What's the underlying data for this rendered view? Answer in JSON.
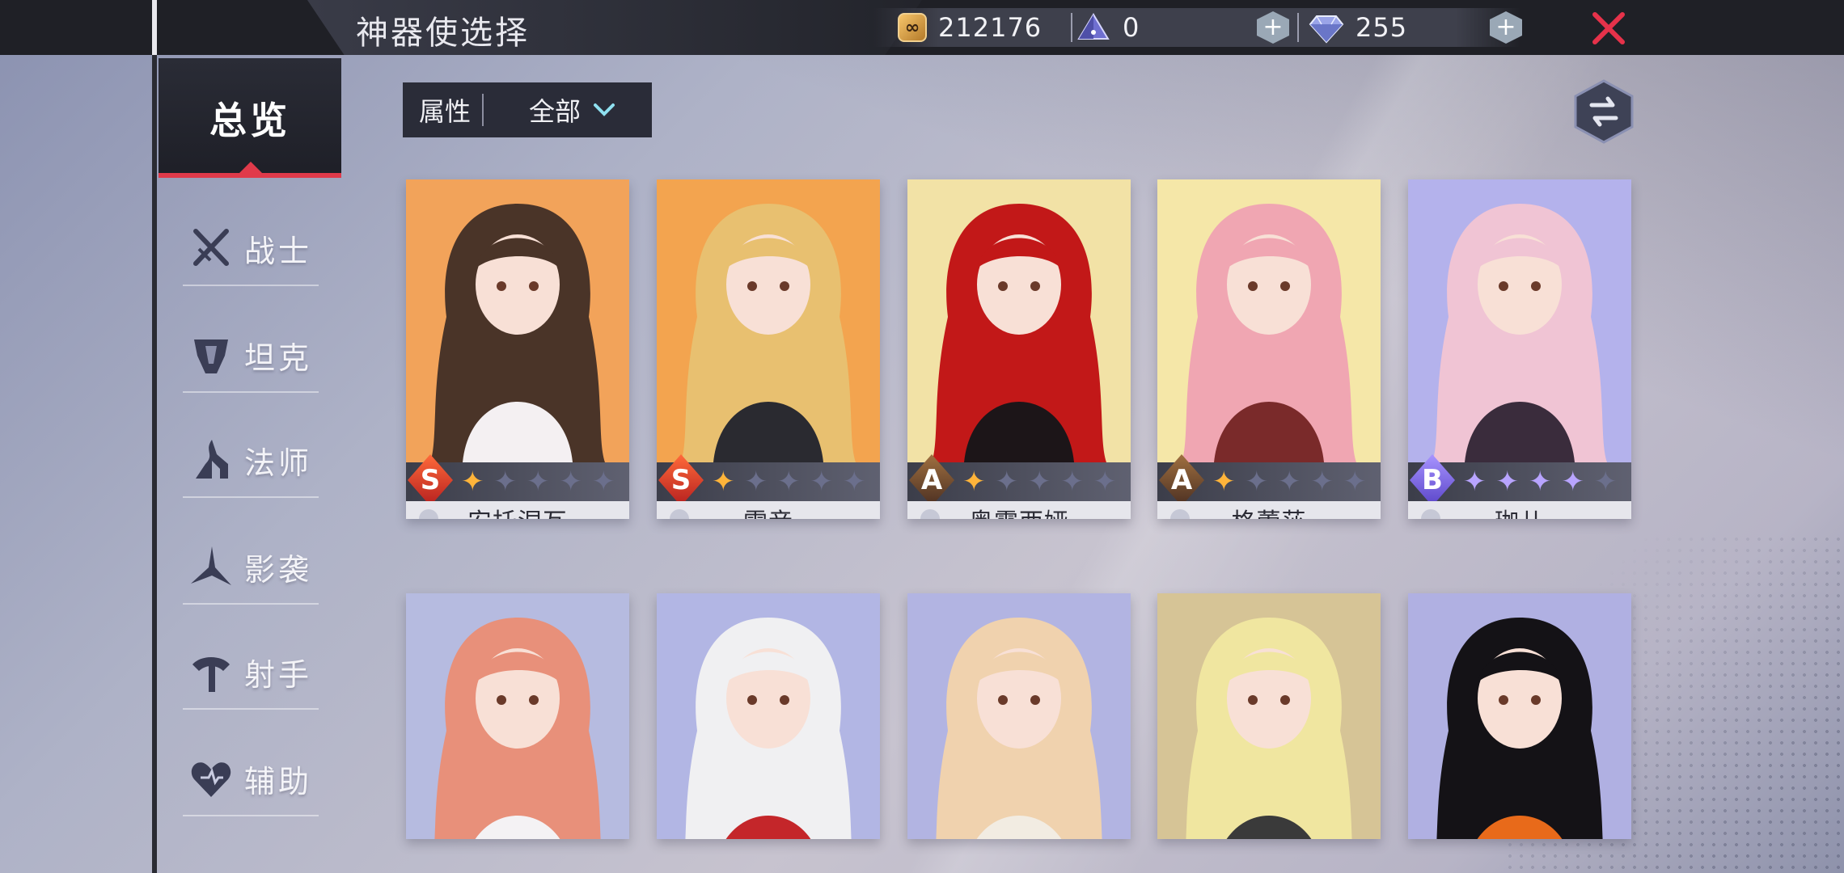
{
  "header": {
    "title": "神器使选择",
    "gold": "212176",
    "crystal": "0",
    "gems": "255"
  },
  "sidebar": {
    "overview": "总览",
    "items": [
      {
        "label": "战士",
        "icon": "warrior-icon"
      },
      {
        "label": "坦克",
        "icon": "tank-icon"
      },
      {
        "label": "法师",
        "icon": "mage-icon"
      },
      {
        "label": "影袭",
        "icon": "assassin-icon"
      },
      {
        "label": "射手",
        "icon": "marksman-icon"
      },
      {
        "label": "辅助",
        "icon": "support-icon"
      }
    ]
  },
  "filter": {
    "label": "属性",
    "value": "全部"
  },
  "cards": [
    {
      "name": "安托涅瓦",
      "rank": "S",
      "stars": 1,
      "role": "mage-icon",
      "colors": {
        "bg": "#f2a35a",
        "hair": "#4a3428",
        "outfit": "#f4f0f2"
      }
    },
    {
      "name": "雷音",
      "rank": "S",
      "stars": 1,
      "role": "mage-icon",
      "colors": {
        "bg": "#f3a44f",
        "hair": "#e8c070",
        "outfit": "#2a2a30"
      }
    },
    {
      "name": "奥露西娅",
      "rank": "A",
      "stars": 1,
      "role": "mage-icon",
      "colors": {
        "bg": "#f2e2a6",
        "hair": "#c21818",
        "outfit": "#1c1518"
      }
    },
    {
      "name": "格蕾莎",
      "rank": "A",
      "stars": 1,
      "role": "support-icon",
      "colors": {
        "bg": "#f5e7a8",
        "hair": "#f0a6b2",
        "outfit": "#7a2a2a"
      }
    },
    {
      "name": "珈儿",
      "rank": "B",
      "stars": 4,
      "role": "warrior-icon",
      "colors": {
        "bg": "#b4b2ec",
        "hair": "#f0c4d4",
        "outfit": "#3a2c3c"
      }
    },
    {
      "name": "",
      "rank": "",
      "stars": 0,
      "role": "",
      "colors": {
        "bg": "#b6bbe0",
        "hair": "#e8907a",
        "outfit": "#f4f2f4"
      }
    },
    {
      "name": "",
      "rank": "",
      "stars": 0,
      "role": "",
      "colors": {
        "bg": "#b2b6e4",
        "hair": "#f0f0f2",
        "outfit": "#c4262a"
      }
    },
    {
      "name": "",
      "rank": "",
      "stars": 0,
      "role": "",
      "colors": {
        "bg": "#b2b4e2",
        "hair": "#f0d2ae",
        "outfit": "#f2ece2"
      }
    },
    {
      "name": "",
      "rank": "",
      "stars": 0,
      "role": "",
      "colors": {
        "bg": "#d6c496",
        "hair": "#f0e6a0",
        "outfit": "#3a3a3a"
      }
    },
    {
      "name": "",
      "rank": "",
      "stars": 0,
      "role": "",
      "colors": {
        "bg": "#b0b0e2",
        "hair": "#141216",
        "outfit": "#e86a1a"
      }
    }
  ]
}
